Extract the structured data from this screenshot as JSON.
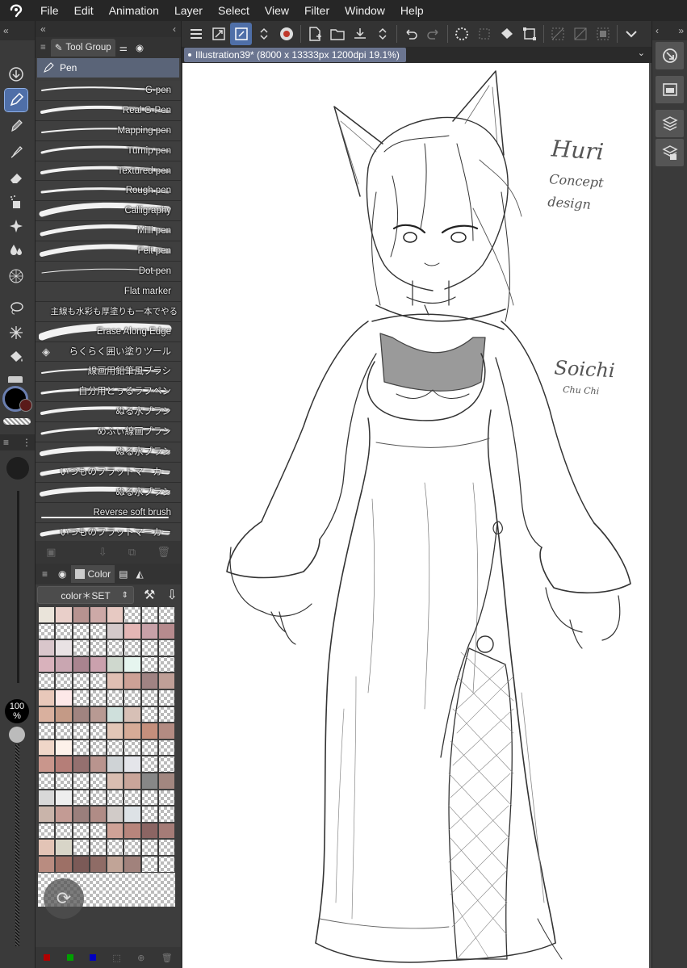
{
  "menubar": {
    "logo": "clip-studio-logo",
    "items": [
      "File",
      "Edit",
      "Animation",
      "Layer",
      "Select",
      "View",
      "Filter",
      "Window",
      "Help"
    ]
  },
  "subtool": {
    "tab_label": "Tool Group",
    "group_name": "Pen",
    "brushes": [
      "G-pen",
      "Real G-Pen",
      "Mapping pen",
      "Turnip pen",
      "Textured pen",
      "Rough pen",
      "Calligraphy",
      "Milli pen",
      "Felt pen",
      "Dot pen",
      "Flat marker",
      "主線も水彩も厚塗りも一本でやる",
      "Erase Along Edge",
      "らくらく囲い塗りツール",
      "線画用鉛筆風ブラシ",
      "自分用とぅるラフペン",
      "ぬる水ブラシ",
      "めふぃ線画ブラシ",
      "ぬる水ブラシ",
      "いつものフラットマーカー",
      "ぬる水ブラシ",
      "Reverse soft brush",
      "いつものフラットマーカー"
    ]
  },
  "colorset": {
    "tab_label": "Color",
    "set_name": "color＊SET",
    "swatches": [
      "#eae4da",
      "#e9cfc9",
      "#b79390",
      "#cda9a7",
      "#e7c9c2",
      "#ffffff",
      "#ffffff",
      "#ffffff",
      "#ffffff",
      "#ffffff",
      "#ffffff",
      "#ffffff",
      "#d4c9ca",
      "#e4b6b5",
      "#c7a1a8",
      "#b68b8e",
      "#d9c6cb",
      "#e9e2e4",
      "#ffffff",
      "#ffffff",
      "#ffffff",
      "#ffffff",
      "#ffffff",
      "#ffffff",
      "#d9b2bc",
      "#c9a6b1",
      "#a9848f",
      "#caa1ad",
      "#cfd8ce",
      "#e6f5ef",
      "#ffffff",
      "#ffffff",
      "#ffffff",
      "#ffffff",
      "#ffffff",
      "#ffffff",
      "#e0bfb3",
      "#cda196",
      "#a08383",
      "#bf9f97",
      "#e8c8ba",
      "#fde8e8",
      "#ffffff",
      "#ffffff",
      "#ffffff",
      "#ffffff",
      "#ffffff",
      "#ffffff",
      "#d9b09e",
      "#c49a86",
      "#a08480",
      "#b89a93",
      "#cfe0dc",
      "#d7c0b6",
      "#ffffff",
      "#ffffff",
      "#ffffff",
      "#ffffff",
      "#ffffff",
      "#ffffff",
      "#e2c6b6",
      "#d6ab97",
      "#c48f7c",
      "#b38b82",
      "#efd6c8",
      "#fdf1ea",
      "#ffffff",
      "#ffffff",
      "#ffffff",
      "#ffffff",
      "#ffffff",
      "#ffffff",
      "#c9968c",
      "#b57e78",
      "#94706f",
      "#b9948e",
      "#cfd3d6",
      "#e4e5ea",
      "#ffffff",
      "#ffffff",
      "#ffffff",
      "#ffffff",
      "#ffffff",
      "#ffffff",
      "#d9bdb1",
      "#c9a59a",
      "#878787",
      "#a28780",
      "#d8d8d8",
      "#eeeeee",
      "#ffffff",
      "#ffffff",
      "#ffffff",
      "#ffffff",
      "#ffffff",
      "#ffffff",
      "#c9b4aa",
      "#c39b94",
      "#9a7f7c",
      "#b08c86",
      "#d1cbc8",
      "#dde2e6",
      "#ffffff",
      "#ffffff",
      "#ffffff",
      "#ffffff",
      "#ffffff",
      "#ffffff",
      "#cfa297",
      "#b7857c",
      "#8b6563",
      "#a57c77",
      "#e3c4b6",
      "#d8d5c8",
      "#ffffff",
      "#ffffff",
      "#ffffff",
      "#ffffff",
      "#ffffff",
      "#ffffff",
      "#b98c80",
      "#9d7066",
      "#7b5a57",
      "#8f6c66",
      "#c1a497",
      "#a1827c",
      "#ffffff",
      "#ffffff"
    ],
    "channels": [
      "#b00000",
      "#00a000",
      "#0000c0"
    ]
  },
  "tools": {
    "opacity_label": "100\n%",
    "main_color": "#000000",
    "sub_color": "#5a1a1a"
  },
  "document": {
    "tab_title": "Illustration39* (8000 x 13333px 1200dpi 19.1%)"
  },
  "canvas": {
    "signature_lines": [
      "Huri",
      "Concept",
      "design",
      "Soichi",
      "Chu Chi"
    ]
  }
}
